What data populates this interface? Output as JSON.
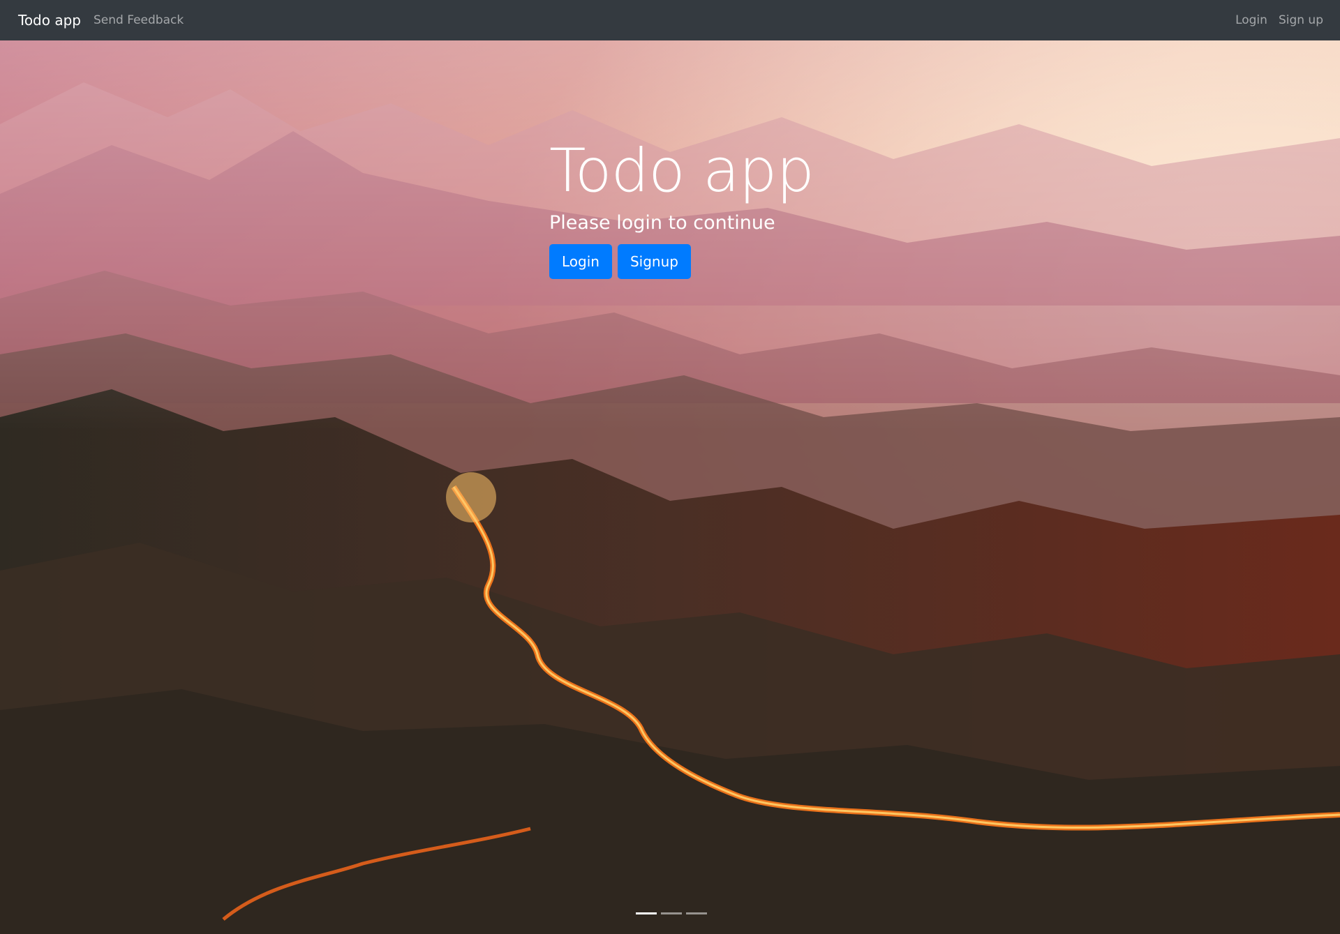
{
  "navbar": {
    "brand": "Todo app",
    "feedback_link": "Send Feedback",
    "login_link": "Login",
    "signup_link": "Sign up"
  },
  "hero": {
    "title": "Todo app",
    "subtitle": "Please login to continue",
    "login_button": "Login",
    "signup_button": "Signup"
  },
  "carousel": {
    "slide_count": 3,
    "active_index": 0
  },
  "colors": {
    "navbar_bg": "#343a40",
    "primary_button": "#007bff"
  }
}
